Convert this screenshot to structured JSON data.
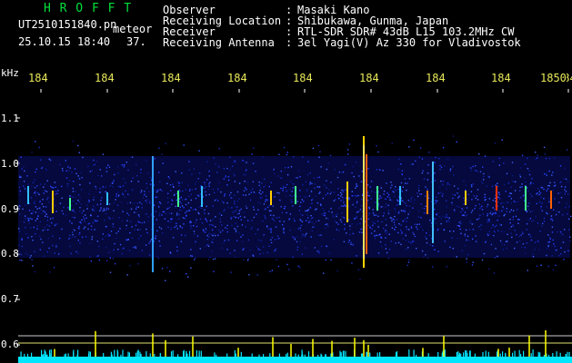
{
  "title": "H R O F F T",
  "file": {
    "name": "UT2510151840.pn",
    "tag": "meteor",
    "timestamp": "25.10.15 18:40",
    "count": "37."
  },
  "info": [
    {
      "label": "Observer",
      "sep": ":",
      "value": "Masaki Kano"
    },
    {
      "label": "Receiving Location",
      "sep": ":",
      "value": "Shibukawa, Gunma, Japan"
    },
    {
      "label": "Receiver",
      "sep": ":",
      "value": "RTL-SDR SDR# 43dB L15 103.2MHz CW"
    },
    {
      "label": "Receiving Antenna",
      "sep": ":",
      "value": "3el Yagi(V) Az 330 for Vladivostok"
    }
  ],
  "y_axis": {
    "unit": "kHz",
    "ticks": [
      "1.1",
      "1.0",
      "0.9",
      "0.8",
      "0.7",
      "0.6"
    ]
  },
  "time_axis": {
    "ticks": [
      "184",
      "184",
      "184",
      "184",
      "184",
      "184",
      "184",
      "184",
      "184",
      "1850"
    ]
  },
  "colors": {
    "background": "#000000",
    "title": "#00e03a",
    "text": "#ffffff",
    "time_ticks": "#e8e85a",
    "noise_band": "#0a1070",
    "echo": "#ffd400",
    "baseline": "#00e6ff",
    "spikes": "#ffff00"
  }
}
